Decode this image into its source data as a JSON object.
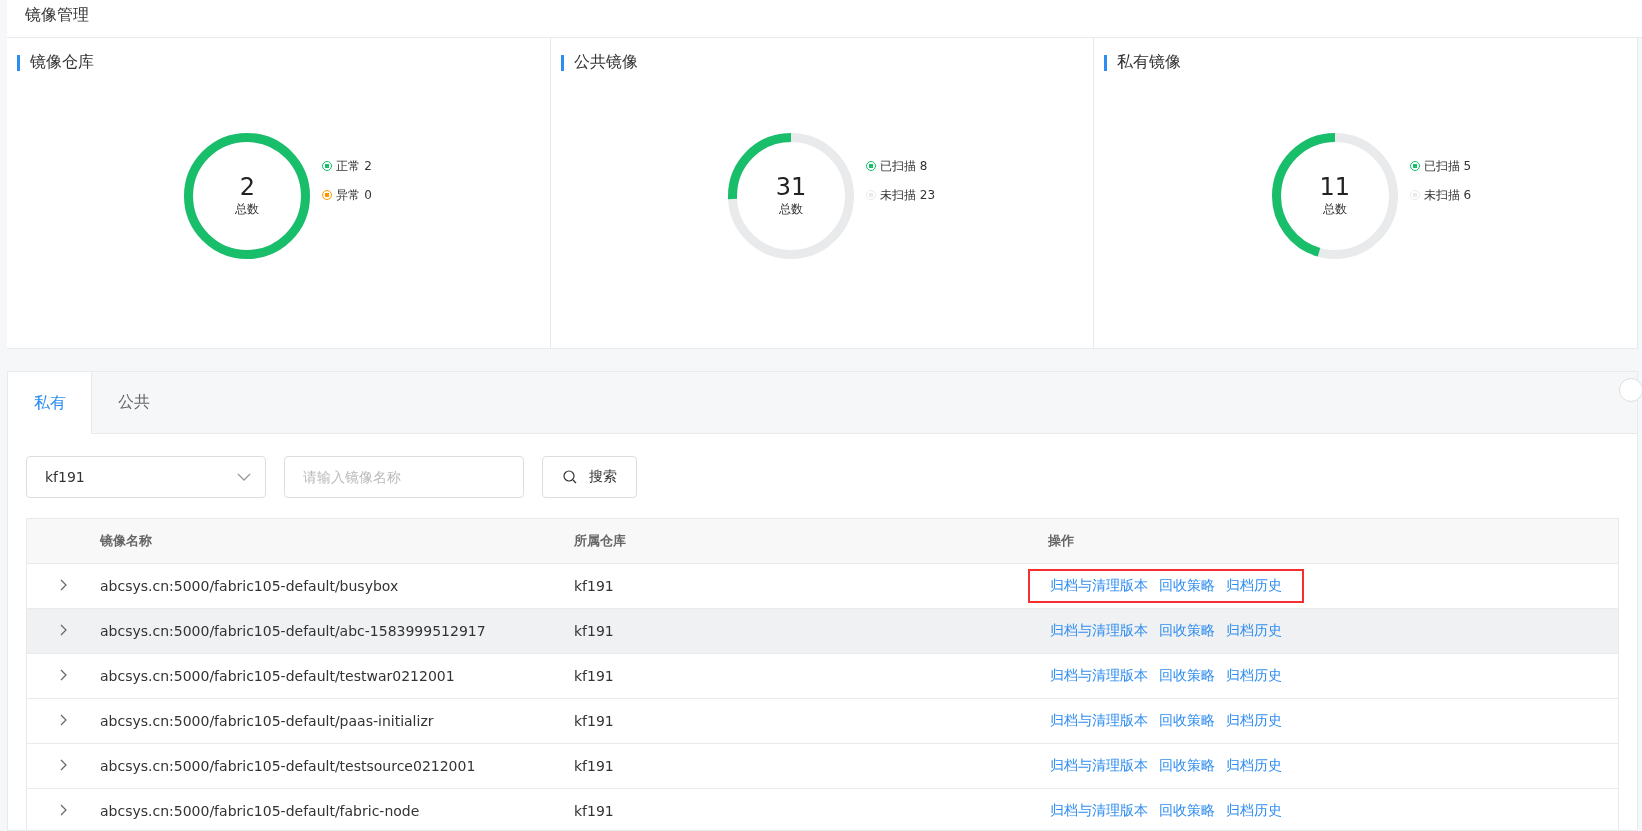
{
  "page_title": "镜像管理",
  "stats": [
    {
      "title": "镜像仓库",
      "total": "2",
      "total_label": "总数",
      "level": 1,
      "legend": [
        {
          "label": "正常 2",
          "color": "#19be6b"
        },
        {
          "label": "异常 0",
          "color": "#ff9900"
        }
      ]
    },
    {
      "title": "公共镜像",
      "total": "31",
      "total_label": "总数",
      "level": 0.258,
      "legend": [
        {
          "label": "已扫描 8",
          "color": "#19be6b"
        },
        {
          "label": "未扫描 23",
          "color": "#e8eaec"
        }
      ]
    },
    {
      "title": "私有镜像",
      "total": "11",
      "total_label": "总数",
      "level": 0.455,
      "legend": [
        {
          "label": "已扫描 5",
          "color": "#19be6b"
        },
        {
          "label": "未扫描 6",
          "color": "#e8eaec"
        }
      ]
    }
  ],
  "tabs": [
    {
      "label": "私有",
      "selected": true
    },
    {
      "label": "公共",
      "selected": false
    }
  ],
  "filters": {
    "repository": "kf191",
    "search": {
      "placeholder": "请输入镜像名称"
    },
    "search_button": "搜索"
  },
  "table": {
    "columns": [
      "镜像名称",
      "所属仓库",
      "操作"
    ],
    "rows": [
      {
        "name": "abcsys.cn:5000/fabric105-default/busybox",
        "repository": "kf191",
        "actions": [
          "归档与清理版本",
          "回收策略",
          "归档历史"
        ],
        "hovered": false,
        "highlighted": true
      },
      {
        "name": "abcsys.cn:5000/fabric105-default/abc-1583999512917",
        "repository": "kf191",
        "actions": [
          "归档与清理版本",
          "回收策略",
          "归档历史"
        ],
        "hovered": true,
        "highlighted": false
      },
      {
        "name": "abcsys.cn:5000/fabric105-default/testwar0212001",
        "repository": "kf191",
        "actions": [
          "归档与清理版本",
          "回收策略",
          "归档历史"
        ],
        "hovered": false,
        "highlighted": false
      },
      {
        "name": "abcsys.cn:5000/fabric105-default/paas-initializr",
        "repository": "kf191",
        "actions": [
          "归档与清理版本",
          "回收策略",
          "归档历史"
        ],
        "hovered": false,
        "highlighted": false
      },
      {
        "name": "abcsys.cn:5000/fabric105-default/testsource0212001",
        "repository": "kf191",
        "actions": [
          "归档与清理版本",
          "回收策略",
          "归档历史"
        ],
        "hovered": false,
        "highlighted": false
      },
      {
        "name": "abcsys.cn:5000/fabric105-default/fabric-node",
        "repository": "kf191",
        "actions": [
          "归档与清理版本",
          "回收策略",
          "归档历史"
        ],
        "hovered": false,
        "highlighted": false
      }
    ]
  }
}
